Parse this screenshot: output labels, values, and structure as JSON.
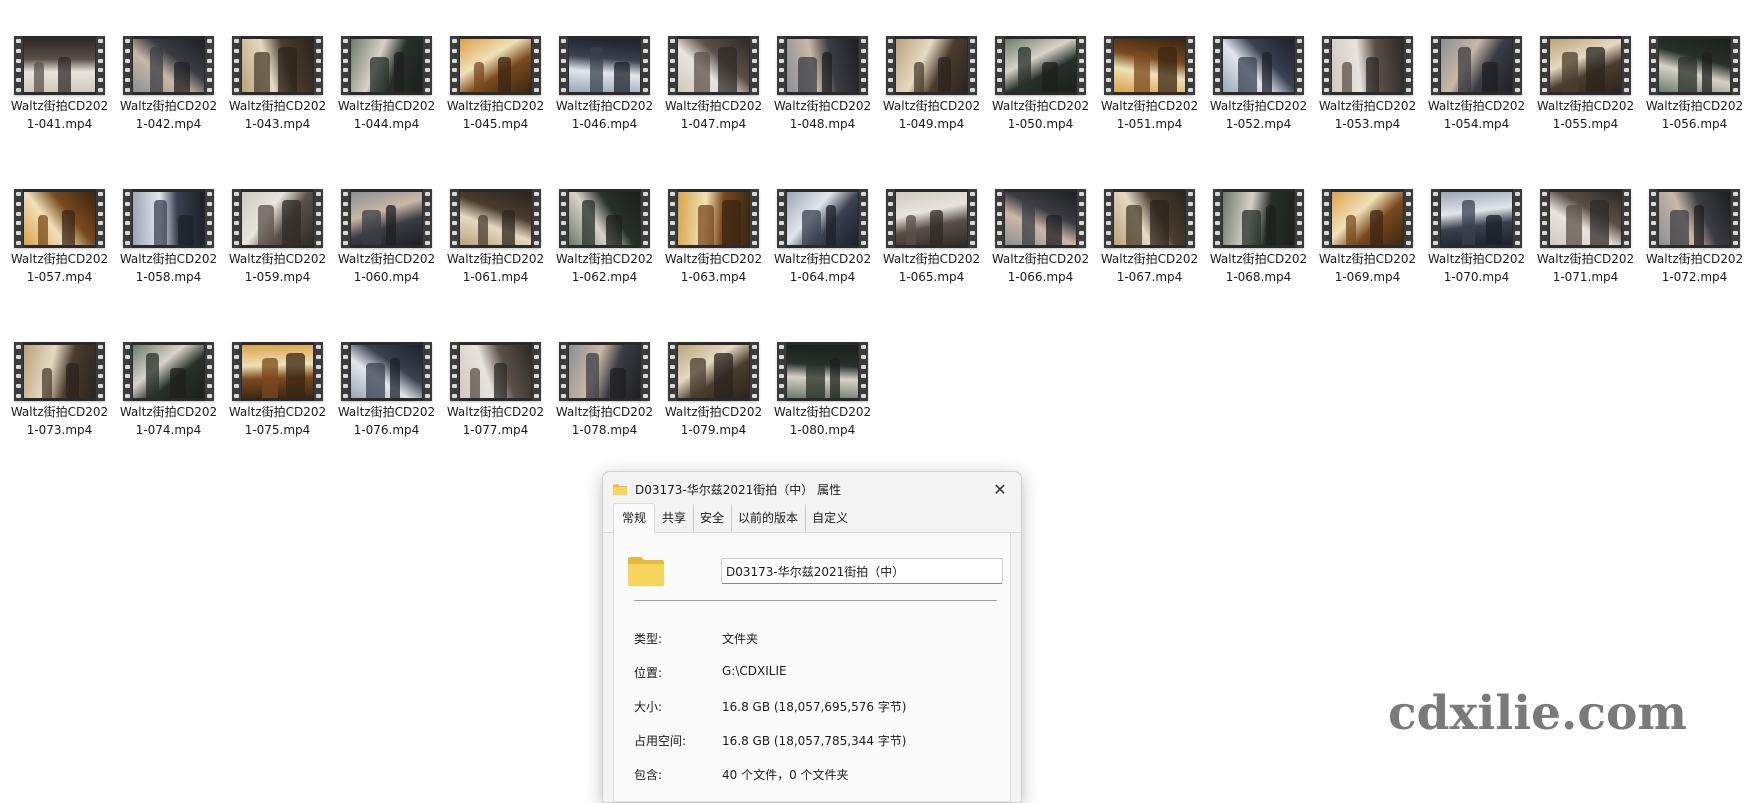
{
  "files": [
    {
      "label": "Waltz街拍CD2021-041.mp4"
    },
    {
      "label": "Waltz街拍CD2021-042.mp4"
    },
    {
      "label": "Waltz街拍CD2021-043.mp4"
    },
    {
      "label": "Waltz街拍CD2021-044.mp4"
    },
    {
      "label": "Waltz街拍CD2021-045.mp4"
    },
    {
      "label": "Waltz街拍CD2021-046.mp4"
    },
    {
      "label": "Waltz街拍CD2021-047.mp4"
    },
    {
      "label": "Waltz街拍CD2021-048.mp4"
    },
    {
      "label": "Waltz街拍CD2021-049.mp4"
    },
    {
      "label": "Waltz街拍CD2021-050.mp4"
    },
    {
      "label": "Waltz街拍CD2021-051.mp4"
    },
    {
      "label": "Waltz街拍CD2021-052.mp4"
    },
    {
      "label": "Waltz街拍CD2021-053.mp4"
    },
    {
      "label": "Waltz街拍CD2021-054.mp4"
    },
    {
      "label": "Waltz街拍CD2021-055.mp4"
    },
    {
      "label": "Waltz街拍CD2021-056.mp4"
    },
    {
      "label": "Waltz街拍CD2021-057.mp4"
    },
    {
      "label": "Waltz街拍CD2021-058.mp4"
    },
    {
      "label": "Waltz街拍CD2021-059.mp4"
    },
    {
      "label": "Waltz街拍CD2021-060.mp4"
    },
    {
      "label": "Waltz街拍CD2021-061.mp4"
    },
    {
      "label": "Waltz街拍CD2021-062.mp4"
    },
    {
      "label": "Waltz街拍CD2021-063.mp4"
    },
    {
      "label": "Waltz街拍CD2021-064.mp4"
    },
    {
      "label": "Waltz街拍CD2021-065.mp4"
    },
    {
      "label": "Waltz街拍CD2021-066.mp4"
    },
    {
      "label": "Waltz街拍CD2021-067.mp4"
    },
    {
      "label": "Waltz街拍CD2021-068.mp4"
    },
    {
      "label": "Waltz街拍CD2021-069.mp4"
    },
    {
      "label": "Waltz街拍CD2021-070.mp4"
    },
    {
      "label": "Waltz街拍CD2021-071.mp4"
    },
    {
      "label": "Waltz街拍CD2021-072.mp4"
    },
    {
      "label": "Waltz街拍CD2021-073.mp4"
    },
    {
      "label": "Waltz街拍CD2021-074.mp4"
    },
    {
      "label": "Waltz街拍CD2021-075.mp4"
    },
    {
      "label": "Waltz街拍CD2021-076.mp4"
    },
    {
      "label": "Waltz街拍CD2021-077.mp4"
    },
    {
      "label": "Waltz街拍CD2021-078.mp4"
    },
    {
      "label": "Waltz街拍CD2021-079.mp4"
    },
    {
      "label": "Waltz街拍CD2021-080.mp4"
    }
  ],
  "dialog": {
    "title": "D03173-华尔兹2021街拍（中） 属性",
    "close_glyph": "✕",
    "tabs": [
      "常规",
      "共享",
      "安全",
      "以前的版本",
      "自定义"
    ],
    "name_value": "D03173-华尔兹2021街拍（中）",
    "props": [
      {
        "key": "类型:",
        "value": "文件夹"
      },
      {
        "key": "位置:",
        "value": "G:\\CDXILIE"
      },
      {
        "key": "大小:",
        "value": "16.8 GB (18,057,695,576 字节)"
      },
      {
        "key": "占用空间:",
        "value": "16.8 GB (18,057,785,344 字节)"
      },
      {
        "key": "包含:",
        "value": "40 个文件，0 个文件夹"
      }
    ]
  },
  "watermark": "cdxilie.com",
  "colors": {
    "folder_yellow": "#f7d45c",
    "folder_dark": "#e9b93a",
    "dialog_bg": "#f3f3f3"
  },
  "icons": {
    "file": "video-file-icon",
    "folder": "folder-icon",
    "close": "close-icon"
  }
}
